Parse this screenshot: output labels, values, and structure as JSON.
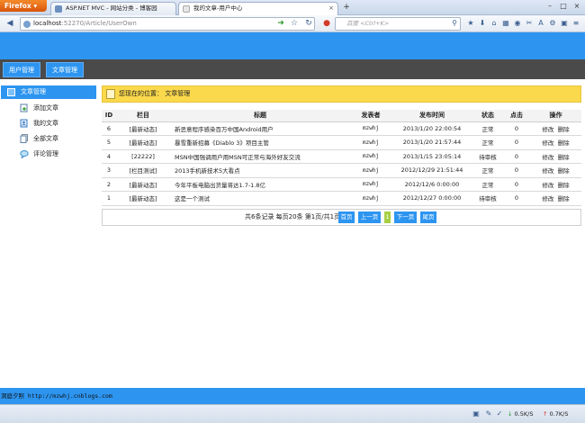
{
  "browser": {
    "menu_label": "Firefox",
    "tabs": [
      {
        "label": "ASP.NET MVC - 网站分类 - 博客园"
      },
      {
        "label": "我的文章-用户中心"
      }
    ],
    "url_host": "localhost",
    "url_path": ":52270/Article/UserOwn",
    "search_placeholder": "百度 <Ctrl+K>"
  },
  "site": {
    "top_menu": [
      "用户管理",
      "文章管理"
    ],
    "sidebar": {
      "header": "文章管理",
      "items": [
        "添加文章",
        "我的文章",
        "全部文章",
        "评论管理"
      ]
    },
    "breadcrumb": "您现在的位置： 文章管理",
    "table": {
      "headers": [
        "ID",
        "栏目",
        "标题",
        "发表者",
        "发布时间",
        "状态",
        "点击",
        "操作"
      ],
      "rows": [
        {
          "id": "6",
          "category": "[最新动态]",
          "title": "新恶意程序感染百万中国Android用户",
          "author": "mzwhj",
          "time": "2013/1/20 22:00:54",
          "status": "正常",
          "clicks": "0",
          "edit": "修改",
          "delete": "删除"
        },
        {
          "id": "5",
          "category": "[最新动态]",
          "title": "暴雪重新招募《Diablo 3》项目主管",
          "author": "mzwhj",
          "time": "2013/1/20 21:57:44",
          "status": "正常",
          "clicks": "0",
          "edit": "修改",
          "delete": "删除"
        },
        {
          "id": "4",
          "category": "[22222]",
          "title": "MSN中国强调用户用MSN可正常与海外好友交流",
          "author": "mzwhj",
          "time": "2013/1/15 23:05:14",
          "status": "待审核",
          "clicks": "0",
          "edit": "修改",
          "delete": "删除"
        },
        {
          "id": "3",
          "category": "[栏目测试]",
          "title": "2013手机新技术5大看点",
          "author": "mzwhj",
          "time": "2012/12/29 21:51:44",
          "status": "正常",
          "clicks": "0",
          "edit": "修改",
          "delete": "删除"
        },
        {
          "id": "2",
          "category": "[最新动态]",
          "title": "今年平板电脑出货量将达1.7-1.8亿",
          "author": "mzwhj",
          "time": "2012/12/6 0:00:00",
          "status": "正常",
          "clicks": "0",
          "edit": "修改",
          "delete": "删除"
        },
        {
          "id": "1",
          "category": "[最新动态]",
          "title": "这是一个测试",
          "author": "mzwhj",
          "time": "2012/12/27 0:00:00",
          "status": "待审核",
          "clicks": "0",
          "edit": "修改",
          "delete": "删除"
        }
      ]
    },
    "pager": {
      "info": "共6条记录 每页20条 第1页/共1页",
      "first": "首页",
      "prev": "上一页",
      "current": "1",
      "next": "下一页",
      "last": "尾页"
    },
    "footer_text": "洞庭夕照 http://mzwhj.cnblogs.com"
  },
  "status": {
    "download": "0.5K/S",
    "upload": "0.7K/S"
  },
  "colors": {
    "brand_blue": "#2d95f0",
    "menu_dark": "#4a4a4a",
    "notice_yellow": "#fbd94c",
    "pager_current": "#a8cf45"
  }
}
